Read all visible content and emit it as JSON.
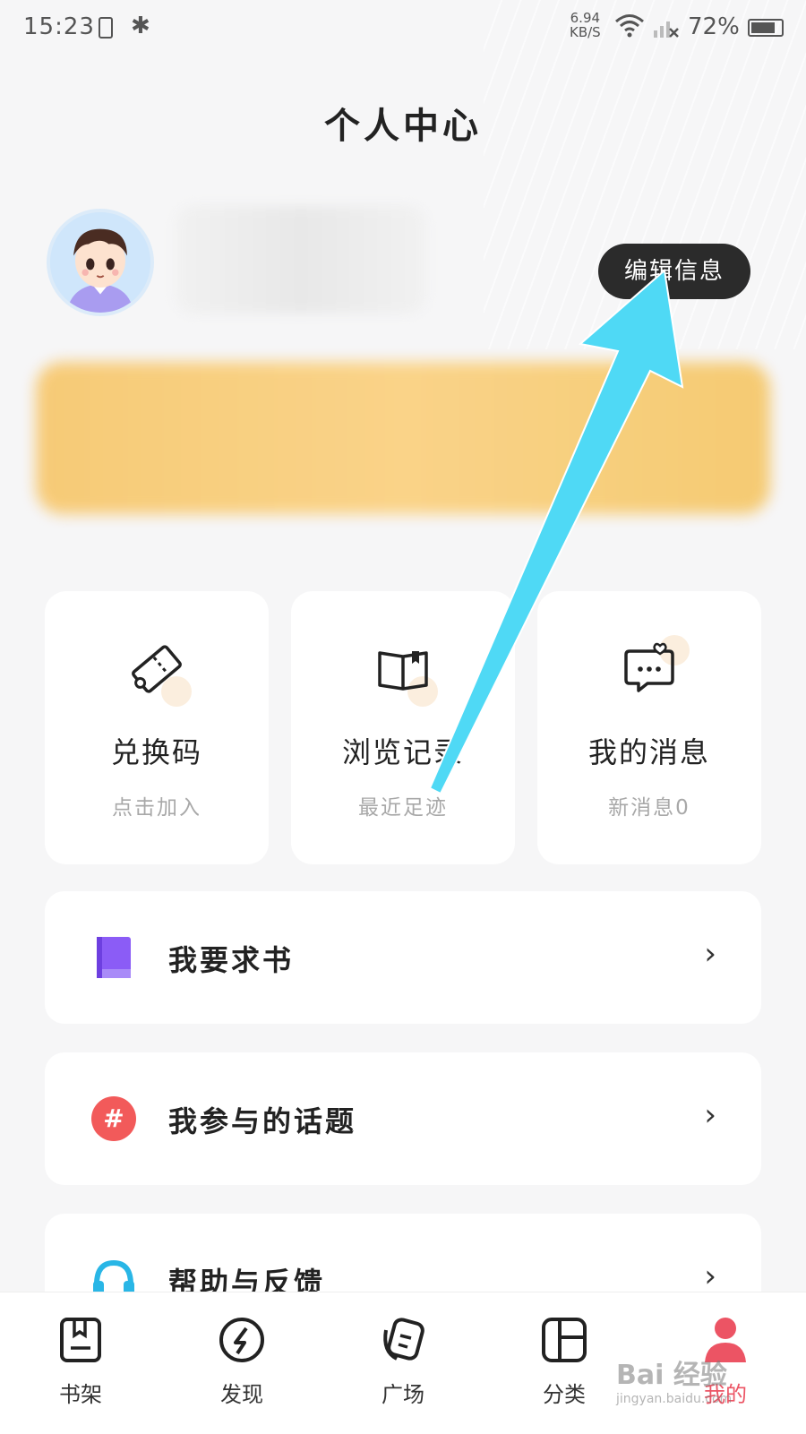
{
  "status_bar": {
    "time": "15:23",
    "net_speed_value": "6.94",
    "net_speed_unit": "KB/S",
    "battery": "72%"
  },
  "page": {
    "title": "个人中心"
  },
  "profile": {
    "edit_button": "编辑信息"
  },
  "cards": [
    {
      "title": "兑换码",
      "subtitle": "点击加入",
      "icon": "ticket-icon"
    },
    {
      "title": "浏览记录",
      "subtitle": "最近足迹",
      "icon": "open-book-icon"
    },
    {
      "title": "我的消息",
      "subtitle": "新消息0",
      "icon": "chat-heart-icon"
    }
  ],
  "menu": [
    {
      "label": "我要求书",
      "icon": "book-icon",
      "color": "#8b5cf6"
    },
    {
      "label": "我参与的话题",
      "icon": "hashtag-icon",
      "color": "#f25a5a"
    },
    {
      "label": "帮助与反馈",
      "icon": "headset-icon",
      "color": "#29b6e6"
    }
  ],
  "bottom_nav": [
    {
      "label": "书架",
      "icon": "bookshelf-icon"
    },
    {
      "label": "发现",
      "icon": "compass-icon"
    },
    {
      "label": "广场",
      "icon": "square-icon"
    },
    {
      "label": "分类",
      "icon": "category-icon"
    },
    {
      "label": "我的",
      "icon": "person-icon",
      "active": true
    }
  ],
  "colors": {
    "accent": "#ec5464",
    "annotation_arrow": "#4fd9f5"
  },
  "watermark": {
    "text": "Bai 经验",
    "sub": "jingyan.baidu.com"
  }
}
